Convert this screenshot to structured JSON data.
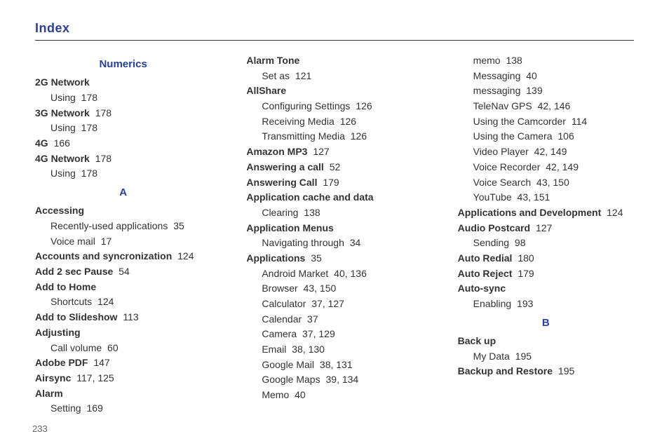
{
  "pageTitle": "Index",
  "pageNumber": "233",
  "columns": [
    [
      {
        "type": "head",
        "text": "Numerics"
      },
      {
        "type": "l1",
        "term": "2G Network"
      },
      {
        "type": "l2",
        "text": "Using",
        "pages": "178"
      },
      {
        "type": "l1",
        "term": "3G Network",
        "pages": "178"
      },
      {
        "type": "l2",
        "text": "Using",
        "pages": "178"
      },
      {
        "type": "l1",
        "term": "4G",
        "pages": "166"
      },
      {
        "type": "l1",
        "term": "4G Network",
        "pages": "178"
      },
      {
        "type": "l2",
        "text": "Using",
        "pages": "178"
      },
      {
        "type": "head",
        "text": "A"
      },
      {
        "type": "l1",
        "term": "Accessing"
      },
      {
        "type": "l2",
        "text": "Recently-used applications",
        "pages": "35"
      },
      {
        "type": "l2",
        "text": "Voice mail",
        "pages": "17"
      },
      {
        "type": "l1",
        "term": "Accounts and syncronization",
        "pages": "124"
      },
      {
        "type": "l1",
        "term": "Add 2 sec Pause",
        "pages": "54"
      },
      {
        "type": "l1",
        "term": "Add to Home"
      },
      {
        "type": "l2",
        "text": "Shortcuts",
        "pages": "124"
      },
      {
        "type": "l1",
        "term": "Add to Slideshow",
        "pages": "113"
      },
      {
        "type": "l1",
        "term": "Adjusting"
      },
      {
        "type": "l2",
        "text": "Call volume",
        "pages": "60"
      },
      {
        "type": "l1",
        "term": "Adobe PDF",
        "pages": "147"
      },
      {
        "type": "l1",
        "term": "Airsync",
        "pages": "117, 125"
      },
      {
        "type": "l1",
        "term": "Alarm"
      },
      {
        "type": "l2",
        "text": "Setting",
        "pages": "169"
      }
    ],
    [
      {
        "type": "l1",
        "term": "Alarm Tone"
      },
      {
        "type": "l2",
        "text": "Set as",
        "pages": "121"
      },
      {
        "type": "l1",
        "term": "AllShare"
      },
      {
        "type": "l2",
        "text": "Configuring Settings",
        "pages": "126"
      },
      {
        "type": "l2",
        "text": "Receiving Media",
        "pages": "126"
      },
      {
        "type": "l2",
        "text": "Transmitting Media",
        "pages": "126"
      },
      {
        "type": "l1",
        "term": "Amazon MP3",
        "pages": "127"
      },
      {
        "type": "l1",
        "term": "Answering a call",
        "pages": "52"
      },
      {
        "type": "l1",
        "term": "Answering Call",
        "pages": "179"
      },
      {
        "type": "l1",
        "term": "Application cache and data"
      },
      {
        "type": "l2",
        "text": "Clearing",
        "pages": "138"
      },
      {
        "type": "l1",
        "term": "Application Menus"
      },
      {
        "type": "l2",
        "text": "Navigating through",
        "pages": "34"
      },
      {
        "type": "l1",
        "term": "Applications",
        "pages": "35"
      },
      {
        "type": "l2",
        "text": "Android Market",
        "pages": "40, 136"
      },
      {
        "type": "l2",
        "text": "Browser",
        "pages": "43, 150"
      },
      {
        "type": "l2",
        "text": "Calculator",
        "pages": "37, 127"
      },
      {
        "type": "l2",
        "text": "Calendar",
        "pages": "37"
      },
      {
        "type": "l2",
        "text": "Camera",
        "pages": "37, 129"
      },
      {
        "type": "l2",
        "text": "Email",
        "pages": "38, 130"
      },
      {
        "type": "l2",
        "text": "Google Mail",
        "pages": "38, 131"
      },
      {
        "type": "l2",
        "text": "Google Maps",
        "pages": "39, 134"
      },
      {
        "type": "l2",
        "text": "Memo",
        "pages": "40"
      }
    ],
    [
      {
        "type": "l2",
        "text": "memo",
        "pages": "138"
      },
      {
        "type": "l2",
        "text": "Messaging",
        "pages": "40"
      },
      {
        "type": "l2",
        "text": "messaging",
        "pages": "139"
      },
      {
        "type": "l2",
        "text": "TeleNav GPS",
        "pages": "42, 146"
      },
      {
        "type": "l2",
        "text": "Using the Camcorder",
        "pages": "114"
      },
      {
        "type": "l2",
        "text": "Using the Camera",
        "pages": "106"
      },
      {
        "type": "l2",
        "text": "Video Player",
        "pages": "42, 149"
      },
      {
        "type": "l2",
        "text": "Voice Recorder",
        "pages": "42, 149"
      },
      {
        "type": "l2",
        "text": "Voice Search",
        "pages": "43, 150"
      },
      {
        "type": "l2",
        "text": "YouTube",
        "pages": "43, 151"
      },
      {
        "type": "l1",
        "term": "Applications and Development",
        "pages": "124"
      },
      {
        "type": "l1",
        "term": "Audio Postcard",
        "pages": "127"
      },
      {
        "type": "l2",
        "text": "Sending",
        "pages": "98"
      },
      {
        "type": "l1",
        "term": "Auto Redial",
        "pages": "180"
      },
      {
        "type": "l1",
        "term": "Auto Reject",
        "pages": "179"
      },
      {
        "type": "l1",
        "term": "Auto-sync"
      },
      {
        "type": "l2",
        "text": "Enabling",
        "pages": "193"
      },
      {
        "type": "head",
        "text": "B"
      },
      {
        "type": "l1",
        "term": "Back up"
      },
      {
        "type": "l2",
        "text": "My Data",
        "pages": "195"
      },
      {
        "type": "l1",
        "term": "Backup and Restore",
        "pages": "195"
      }
    ]
  ]
}
